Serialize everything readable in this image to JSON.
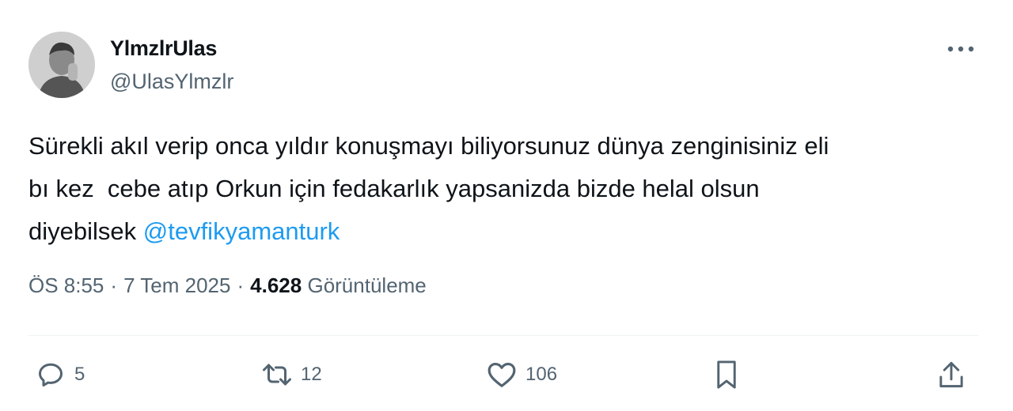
{
  "author": {
    "display_name": "YlmzlrUlas",
    "handle": "@UlasYlmzlr"
  },
  "tweet": {
    "text_line1": "Sürekli akıl verip onca yıldır konuşmayı biliyorsunuz dünya zenginisiniz eli",
    "text_line2": "bı kez  cebe atıp Orkun için fedakarlık yapsanizda bizde helal olsun",
    "text_line3_prefix": "diyebilsek ",
    "mention": "@tevfikyamanturk"
  },
  "meta": {
    "time": "ÖS 8:55",
    "separator": "·",
    "date": "7 Tem 2025",
    "views_count": "4.628",
    "views_label": "Görüntüleme"
  },
  "actions": {
    "reply_count": "5",
    "retweet_count": "12",
    "like_count": "106"
  },
  "icons": {
    "more": "more-dots-icon",
    "reply": "reply-bubble-icon",
    "retweet": "retweet-icon",
    "like": "heart-icon",
    "bookmark": "bookmark-icon",
    "share": "share-icon"
  },
  "colors": {
    "text": "#0f1419",
    "secondary": "#536471",
    "link": "#1d9bf0",
    "divider": "#eff3f4"
  }
}
